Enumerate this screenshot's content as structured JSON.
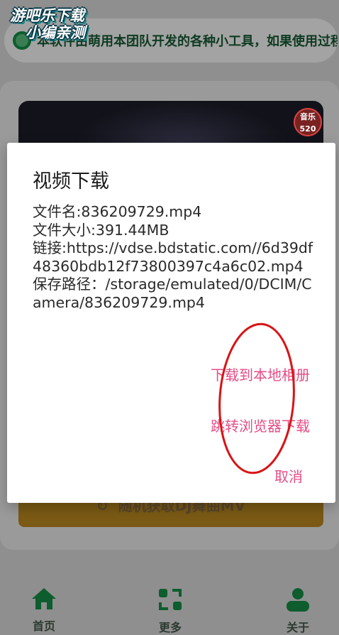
{
  "watermark": {
    "line1": "游吧乐下载",
    "line2": "小编亲测"
  },
  "notice": {
    "text": "本软件由萌用本团队开发的各种小工具，如果使用过程遇到问题请反馈"
  },
  "video": {
    "badge_line1": "音乐",
    "badge_line2": "520"
  },
  "main": {
    "random_button_icon": "refresh-icon",
    "random_button_label": "随机获取DJ舞曲MV"
  },
  "nav": {
    "items": [
      {
        "label": "首页",
        "icon": "home-icon"
      },
      {
        "label": "更多",
        "icon": "switch-icon"
      },
      {
        "label": "关于",
        "icon": "user-icon"
      }
    ]
  },
  "dialog": {
    "title": "视频下载",
    "filename": "文件名:836209729.mp4",
    "filesize": "文件大小:391.44MB",
    "link": "链接:https://vdse.bdstatic.com//6d39df48360bdb12f73800397c4a6c02.mp4",
    "save_path": "保存路径：/storage/emulated/0/DCIM/Camera/836209729.mp4",
    "action_save": "下载到本地相册",
    "action_browser": "跳转浏览器下载",
    "action_cancel": "取消"
  },
  "colors": {
    "accent": "#e44d86",
    "annotation": "#d81414"
  }
}
